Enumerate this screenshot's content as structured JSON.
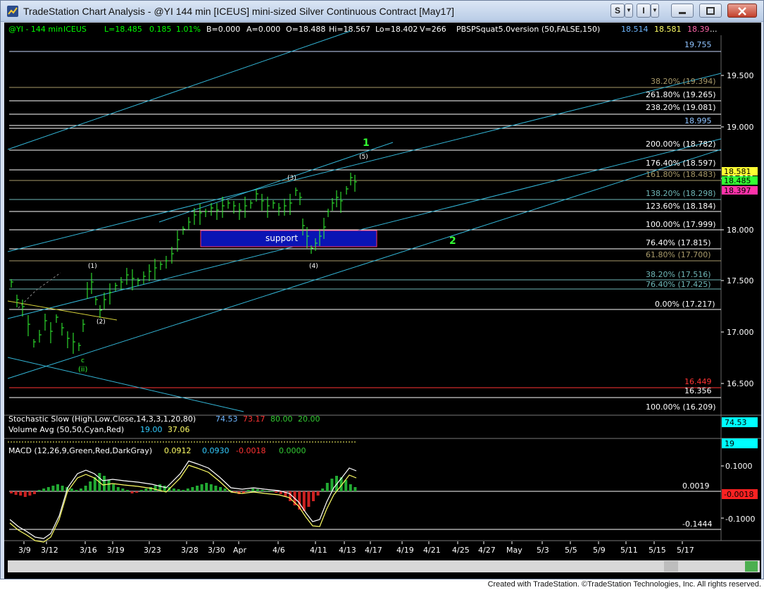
{
  "window": {
    "title": "TradeStation Chart Analysis - @YI 144 min [ICEUS] mini-sized Silver Continuous Contract [May17]",
    "buttons": {
      "s": "S",
      "i": "I"
    }
  },
  "header": {
    "symbol": "@YI - 144 min",
    "exchange": "ICEUS",
    "last": "L=18.485",
    "change": "0.185",
    "pct": "1.01%",
    "b": "B=0.000",
    "a": "A=0.000",
    "open": "O=18.488",
    "hi": "Hi=18.567",
    "lo": "Lo=18.402",
    "vol": "V=266",
    "study": "PBSPSquat5.0version (50,FALSE,150)",
    "v1": "18.514",
    "v2": "18.581",
    "v3": "18.39",
    "more": "..."
  },
  "price_axis": [
    "19.500",
    "19.000",
    "18.500",
    "18.000",
    "17.500",
    "17.000",
    "16.500"
  ],
  "fib_labels": [
    {
      "text": "19.755",
      "color": "#8fc3ff"
    },
    {
      "text": "38.20% (19.394)",
      "color": "#a89a6a"
    },
    {
      "text": "261.80% (19.265)",
      "color": "#ffffff"
    },
    {
      "text": "238.20% (19.081)",
      "color": "#ffffff"
    },
    {
      "text": "18.995",
      "color": "#8fc3ff"
    },
    {
      "text": "200.00% (18.782)",
      "color": "#ffffff"
    },
    {
      "text": "176.40% (18.597)",
      "color": "#ffffff"
    },
    {
      "text": "161.80% (18.483)",
      "color": "#a89a6a"
    },
    {
      "text": "138.20% (18.298)",
      "color": "#6fb7b7"
    },
    {
      "text": "123.60% (18.184)",
      "color": "#ffffff"
    },
    {
      "text": "100.00% (17.999)",
      "color": "#ffffff"
    },
    {
      "text": "76.40% (17.815)",
      "color": "#ffffff"
    },
    {
      "text": "61.80% (17.700)",
      "color": "#a89a6a"
    },
    {
      "text": "38.20% (17.516)",
      "color": "#6fb7b7"
    },
    {
      "text": "76.40% (17.425)",
      "color": "#6fb7b7"
    },
    {
      "text": "0.00% (17.217)",
      "color": "#ffffff"
    },
    {
      "text": "16.449",
      "color": "#ff3333"
    },
    {
      "text": "16.356",
      "color": "#ffffff"
    },
    {
      "text": "100.00% (16.209)",
      "color": "#ffffff"
    }
  ],
  "price_tags": [
    "18.581",
    "18.485",
    "18.397"
  ],
  "wave_labels": {
    "w1": "1",
    "w2": "2",
    "w5": "(5)",
    "w3": "(3)",
    "w4": "(4)",
    "wi1": "(1)",
    "wi2": "(2)",
    "c": "c",
    "ii": "(ii)"
  },
  "support_label": "support",
  "stochastic": {
    "title": "Stochastic Slow (High,Low,Close,14,3,3,1,20,80)",
    "v1": "74.53",
    "v2": "73.17",
    "v3": "80.00",
    "v4": "20.00",
    "tag": "74.53"
  },
  "volume": {
    "title": "Volume Avg (50,50,Cyan,Red)",
    "v1": "19.00",
    "v2": "37.06",
    "tag": "19"
  },
  "macd": {
    "title": "MACD (12,26,9,Green,Red,DarkGray)",
    "v1": "0.0912",
    "v2": "0.0930",
    "v3": "-0.0018",
    "v4": "0.0000",
    "axis": [
      "0.1000",
      "-0.1000"
    ],
    "labels": [
      "0.0019",
      "-0.1444"
    ],
    "tag": "-0.0018"
  },
  "date_axis": [
    "3/9",
    "3/12",
    "3/16",
    "3/19",
    "3/23",
    "3/28",
    "3/30",
    "Apr",
    "4/6",
    "4/11",
    "4/13",
    "4/17",
    "4/19",
    "4/21",
    "4/25",
    "4/27",
    "May",
    "5/3",
    "5/5",
    "5/9",
    "5/11",
    "5/15",
    "5/17"
  ],
  "footer": "Created with TradeStation. ©TradeStation Technologies, Inc. All rights reserved."
}
